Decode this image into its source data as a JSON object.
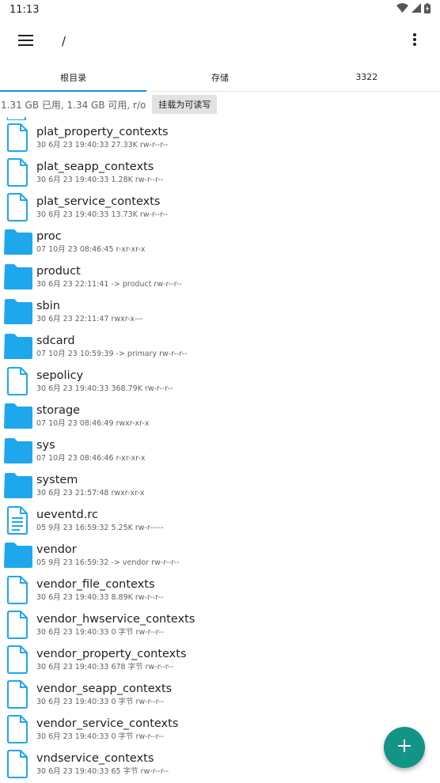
{
  "status_bar": {
    "time": "11:13"
  },
  "app_bar": {
    "path": "/"
  },
  "tabs": [
    {
      "label": "根目录"
    },
    {
      "label": "存储"
    },
    {
      "label": "3322"
    }
  ],
  "storage": {
    "info": "1.31 GB 已用, 1.34 GB 可用, r/o",
    "mount_button": "挂载为可读写"
  },
  "colors": {
    "accent": "#1a8fd6",
    "folder": "#1fa7ee",
    "fab": "#139487"
  },
  "files": [
    {
      "name": "plat_property_contexts",
      "meta": "30 6月 23 19:40:33  27.33K  rw-r--r--",
      "type": "file"
    },
    {
      "name": "plat_seapp_contexts",
      "meta": "30 6月 23 19:40:33  1.28K  rw-r--r--",
      "type": "file"
    },
    {
      "name": "plat_service_contexts",
      "meta": "30 6月 23 19:40:33  13.73K  rw-r--r--",
      "type": "file"
    },
    {
      "name": "proc",
      "meta": "07 10月 23 08:46:45    r-xr-xr-x",
      "type": "folder"
    },
    {
      "name": "product",
      "meta": "30 6月 23 22:11:41  -> product  rw-r--r--",
      "type": "folder"
    },
    {
      "name": "sbin",
      "meta": "30 6月 23 22:11:47    rwxr-x---",
      "type": "folder"
    },
    {
      "name": "sdcard",
      "meta": "07 10月 23 10:59:39  -> primary  rw-r--r--",
      "type": "folder"
    },
    {
      "name": "sepolicy",
      "meta": "30 6月 23 19:40:33  368.79K  rw-r--r--",
      "type": "file"
    },
    {
      "name": "storage",
      "meta": "07 10月 23 08:46:49    rwxr-xr-x",
      "type": "folder"
    },
    {
      "name": "sys",
      "meta": "07 10月 23 08:46:46    r-xr-xr-x",
      "type": "folder"
    },
    {
      "name": "system",
      "meta": "30 6月 23 21:57:48    rwxr-xr-x",
      "type": "folder"
    },
    {
      "name": "ueventd.rc",
      "meta": "05 9月 23 16:59:32  5.25K  rw-r-----",
      "type": "text"
    },
    {
      "name": "vendor",
      "meta": "05 9月 23 16:59:32  -> vendor  rw-r--r--",
      "type": "folder"
    },
    {
      "name": "vendor_file_contexts",
      "meta": "30 6月 23 19:40:33  8.89K  rw-r--r--",
      "type": "file"
    },
    {
      "name": "vendor_hwservice_contexts",
      "meta": "30 6月 23 19:40:33  0 字节  rw-r--r--",
      "type": "file"
    },
    {
      "name": "vendor_property_contexts",
      "meta": "30 6月 23 19:40:33  678 字节  rw-r--r--",
      "type": "file"
    },
    {
      "name": "vendor_seapp_contexts",
      "meta": "30 6月 23 19:40:33  0 字节  rw-r--r--",
      "type": "file"
    },
    {
      "name": "vendor_service_contexts",
      "meta": "30 6月 23 19:40:33  0 字节  rw-r--r--",
      "type": "file"
    },
    {
      "name": "vndservice_contexts",
      "meta": "30 6月 23 19:40:33  65 字节  rw-r--r--",
      "type": "file"
    }
  ]
}
